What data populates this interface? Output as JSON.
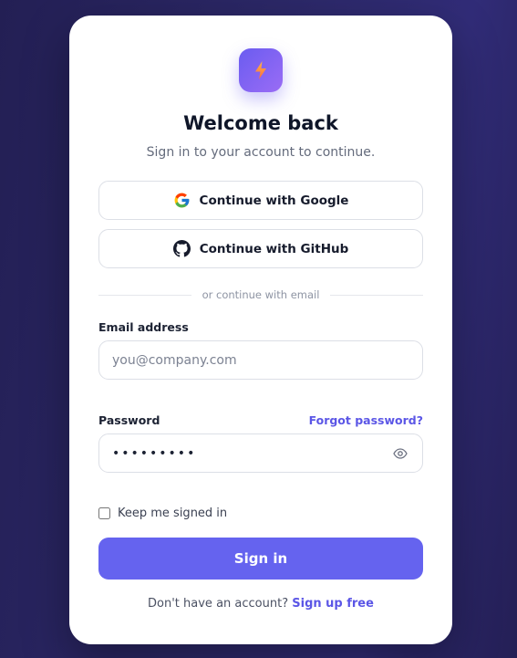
{
  "header": {
    "logo_icon": "lightning-bolt-icon",
    "title": "Welcome back",
    "subtitle": "Sign in to your account to continue."
  },
  "oauth": {
    "google_label": "Continue with Google",
    "google_icon": "google-icon",
    "github_label": "Continue with GitHub",
    "github_icon": "github-icon"
  },
  "divider": {
    "text": "or continue with email"
  },
  "email": {
    "label": "Email address",
    "placeholder": "you@company.com",
    "value": ""
  },
  "password": {
    "label": "Password",
    "value": "•••••••••",
    "forgot_label": "Forgot password?",
    "toggle_icon": "eye-icon"
  },
  "remember": {
    "label": "Keep me signed in",
    "checked": false
  },
  "submit": {
    "label": "Sign in"
  },
  "footer": {
    "prompt": "Don't have an account?",
    "link": "Sign up free"
  },
  "colors": {
    "accent": "#6563ef",
    "link": "#5b56e6",
    "background": "#2c2868",
    "card": "#ffffff"
  }
}
